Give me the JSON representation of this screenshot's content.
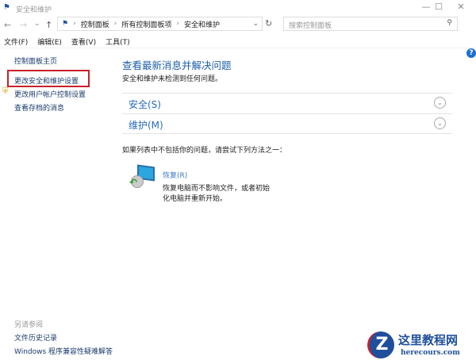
{
  "window": {
    "title": "安全和维护",
    "minimize": "—",
    "maximize": "☐",
    "close": "✕"
  },
  "nav": {
    "back": "←",
    "forward": "→",
    "recent": "⌄",
    "up": "↑",
    "dropdown": "⌄",
    "refresh": "↻",
    "breadcrumb": [
      "控制面板",
      "所有控制面板项",
      "安全和维护"
    ],
    "sep": "›"
  },
  "search": {
    "placeholder": "搜索控制面板",
    "icon": "⚲"
  },
  "menu": [
    "文件(F)",
    "编辑(E)",
    "查看(V)",
    "工具(T)"
  ],
  "sidebar": {
    "items": [
      "控制面板主页",
      "更改安全和维护设置",
      "更改用户帐户控制设置",
      "查看存档的消息"
    ],
    "see_also": "另请参阅",
    "see_also_items": [
      "文件历史记录",
      "Windows 程序兼容性疑难解答"
    ]
  },
  "main": {
    "title": "查看最新消息并解决问题",
    "subtitle": "安全和维护未检测到任何问题。",
    "sections": [
      "安全(S)",
      "维护(M)"
    ],
    "hint": "如果列表中不包括你的问题，请尝试下列方法之一：",
    "recovery": {
      "label": "恢复(R)",
      "desc1": "恢复电脑而不影响文件，或者初始",
      "desc2": "化电脑并重新开始。"
    }
  },
  "help": "?",
  "watermark": {
    "name": "这里教程网",
    "url": "herecours.com",
    "letter": "Z"
  }
}
